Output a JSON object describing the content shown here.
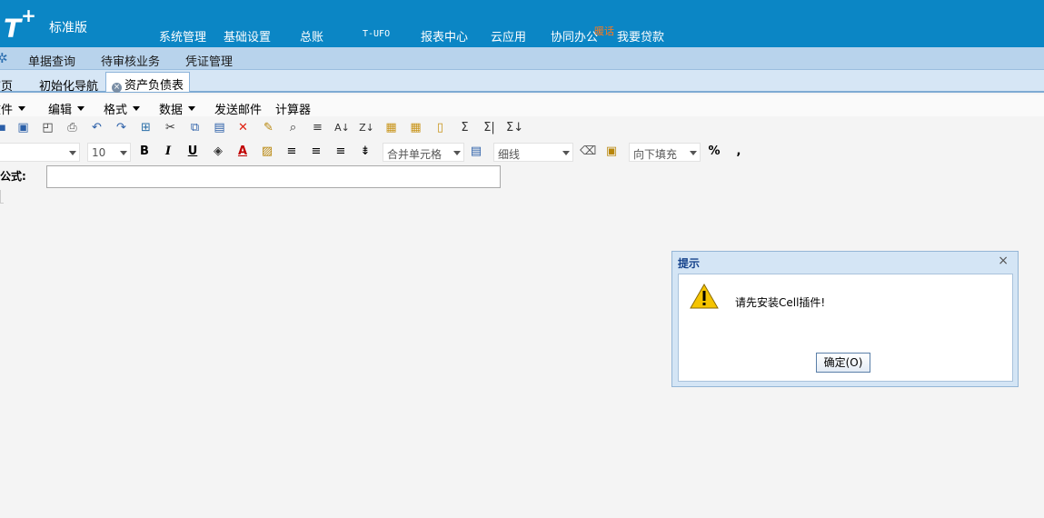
{
  "header": {
    "logo": "T",
    "logo_plus": "+",
    "edition": "标准版",
    "nav": [
      "系统管理",
      "基础设置",
      "总账",
      "T-UFO",
      "报表中心",
      "云应用",
      "协同办公",
      "我要贷款"
    ],
    "hot_badge": "暖话"
  },
  "subbar": {
    "items": [
      "单据查询",
      "待审核业务",
      "凭证管理"
    ]
  },
  "tabs": {
    "items": [
      "首页",
      "初始化导航"
    ],
    "active": "资产负债表",
    "close_glyph": "×"
  },
  "menu": {
    "items": [
      "文件",
      "编辑",
      "格式",
      "数据",
      "发送邮件",
      "计算器"
    ]
  },
  "toolbar2": {
    "font_size": "10",
    "merge_cells": "合并单元格",
    "line_style": "细线",
    "fill_down": "向下填充",
    "percent": "%",
    "comma": ","
  },
  "formula": {
    "label": "输入公式:",
    "value": ""
  },
  "dialog": {
    "title": "提示",
    "message": "请先安装Cell插件!",
    "ok_label": "确定(O)",
    "close_glyph": "×"
  },
  "colors": {
    "header_blue": "#0b86c5",
    "subbar_blue": "#b8d3ec",
    "hot_orange": "#ff7a1a",
    "dialog_title": "#15428b"
  }
}
